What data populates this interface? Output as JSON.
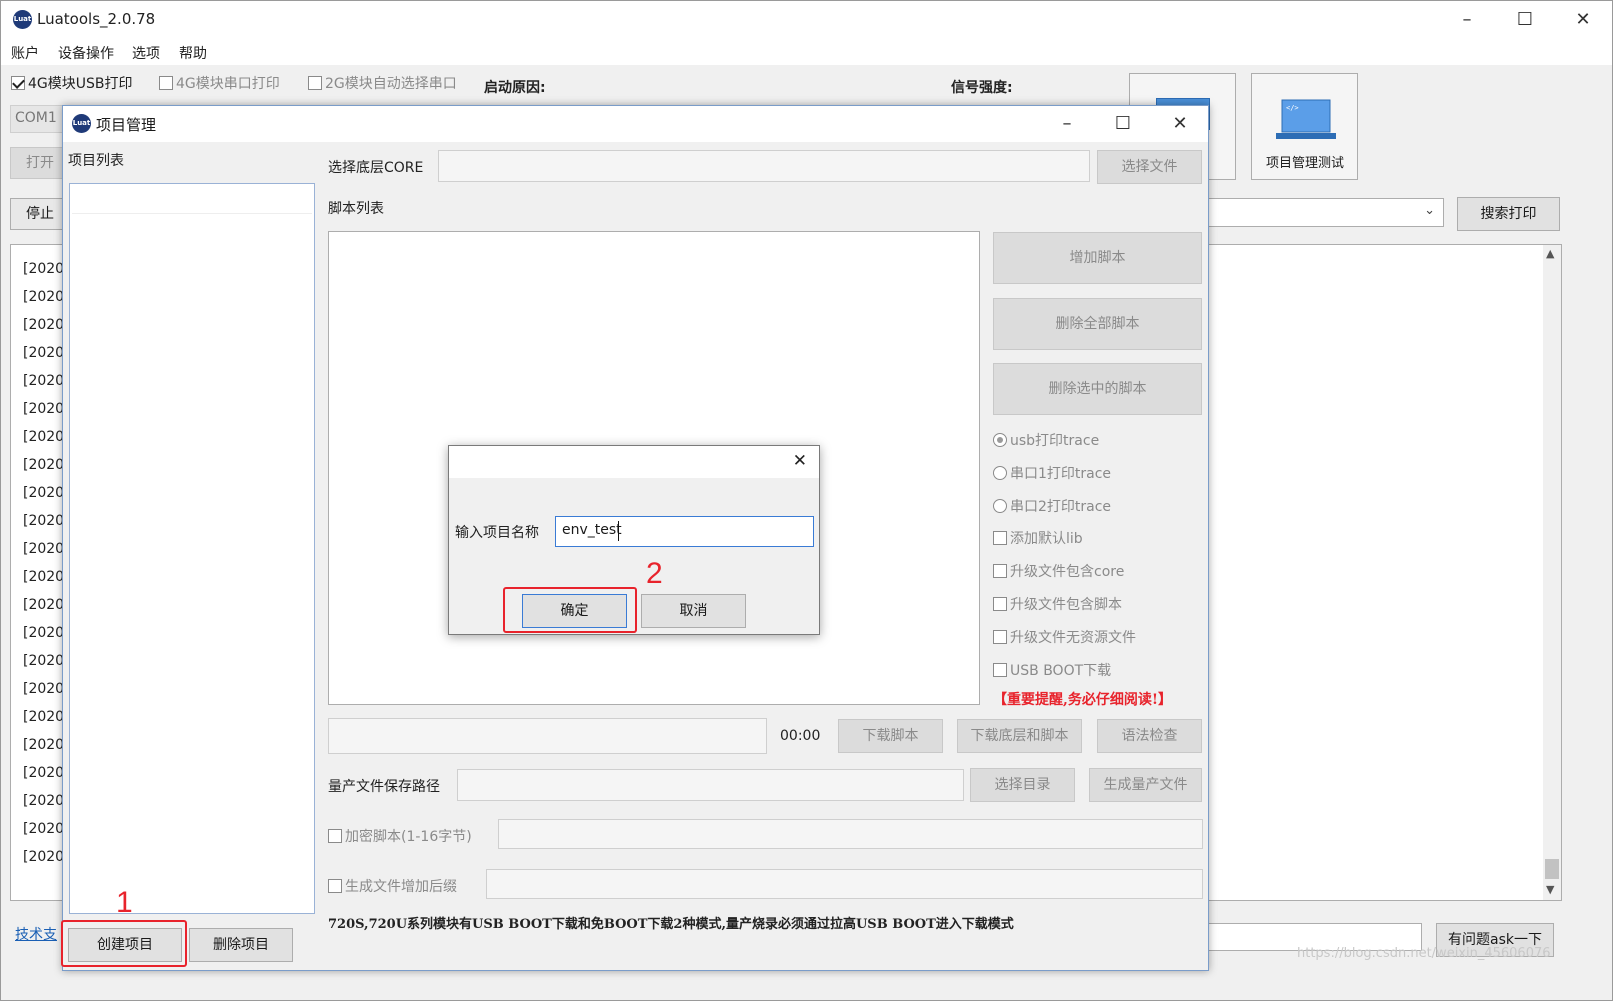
{
  "app": {
    "title": "Luatools_2.0.78",
    "logo_text": "Luat"
  },
  "menu": [
    "账户",
    "设备操作",
    "选项",
    "帮助"
  ],
  "top_options": {
    "usb_print": "4G模块USB打印",
    "serial_print": "4G模块串口打印",
    "auto_select": "2G模块自动选择串口"
  },
  "status": {
    "boot_reason_label": "启动原因:",
    "signal_label": "信号强度:"
  },
  "com_port": "COM1",
  "open_button": "打开",
  "stop_button": "停止",
  "project_test_tile": "项目管理测试",
  "search_print_button": "搜索打印",
  "log_prefix": "[2020-0",
  "log_count": 22,
  "tech_support_link": "技术支",
  "ask_button": "有问题ask一下",
  "watermark": "https://blog.csdn.net/weixin_45606076",
  "project_manager": {
    "title": "项目管理",
    "project_list_label": "项目列表",
    "select_core_label": "选择底层CORE",
    "select_file_button": "选择文件",
    "script_list_label": "脚本列表",
    "add_script_button": "增加脚本",
    "delete_all_scripts_button": "删除全部脚本",
    "delete_selected_scripts_button": "删除选中的脚本",
    "options": {
      "usb_trace": "usb打印trace",
      "uart1_trace": "串口1打印trace",
      "uart2_trace": "串口2打印trace",
      "add_default_lib": "添加默认lib",
      "include_core": "升级文件包含core",
      "include_script": "升级文件包含脚本",
      "no_resource": "升级文件无资源文件",
      "usb_boot": "USB BOOT下载"
    },
    "important_notice": "【重要提醒,务必仔细阅读!】",
    "time": "00:00",
    "download_script_button": "下载脚本",
    "download_core_script_button": "下载底层和脚本",
    "syntax_check_button": "语法检查",
    "production_path_label": "量产文件保存路径",
    "select_dir_button": "选择目录",
    "generate_production_button": "生成量产文件",
    "encrypt_script_label": "加密脚本(1-16字节)",
    "add_suffix_label": "生成文件增加后缀",
    "footer_note": "720S,720U系列模块有USB BOOT下载和免BOOT下载2种模式,量产烧录必须通过拉高USB BOOT进入下载模式",
    "create_project_button": "创建项目",
    "delete_project_button": "删除项目"
  },
  "dialog": {
    "input_label": "输入项目名称",
    "input_value": "env_test",
    "ok_button": "确定",
    "cancel_button": "取消"
  },
  "annotations": {
    "step1": "1",
    "step2": "2"
  }
}
